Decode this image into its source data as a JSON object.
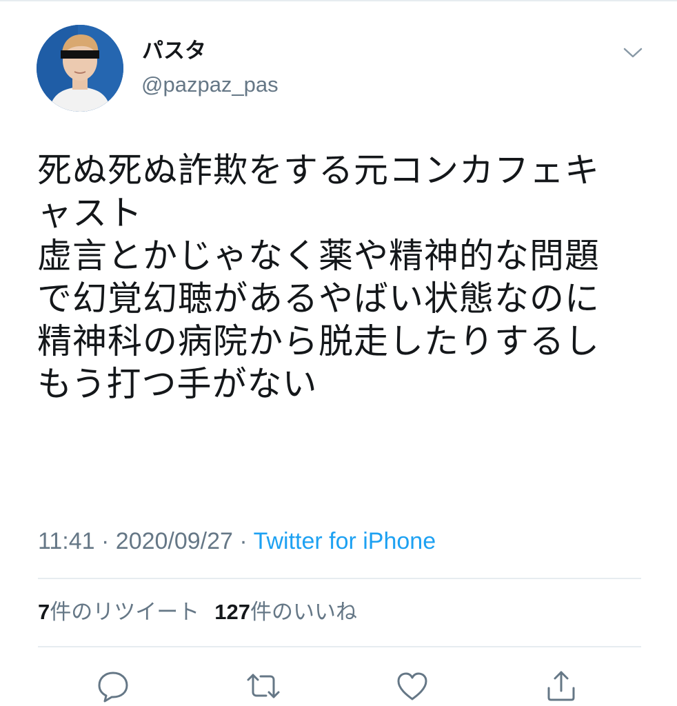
{
  "author": {
    "display_name": "パスタ",
    "handle": "@pazpaz_pas"
  },
  "tweet": {
    "lines": [
      "死ぬ死ぬ詐欺をする元コンカフェキ",
      "ャスト",
      "虚言とかじゃなく薬や精神的な問題",
      "で幻覚幻聴があるやばい状態なのに",
      "精神科の病院から脱走したりするし",
      "もう打つ手がない"
    ],
    "time": "11:41",
    "date": "2020/09/27",
    "separator": " · ",
    "source": "Twitter for iPhone"
  },
  "stats": {
    "retweets_count": "7",
    "retweets_label": "件のリツイート",
    "likes_count": "127",
    "likes_label": "件のいいね"
  },
  "icons": {
    "menu": "chevron-down-icon",
    "reply": "reply-icon",
    "retweet": "retweet-icon",
    "like": "heart-icon",
    "share": "share-icon"
  },
  "colors": {
    "text": "#14171a",
    "secondary": "#657786",
    "link": "#1da1f2",
    "divider": "#e6ecf0",
    "avatar_bg": "#1f5da6"
  }
}
